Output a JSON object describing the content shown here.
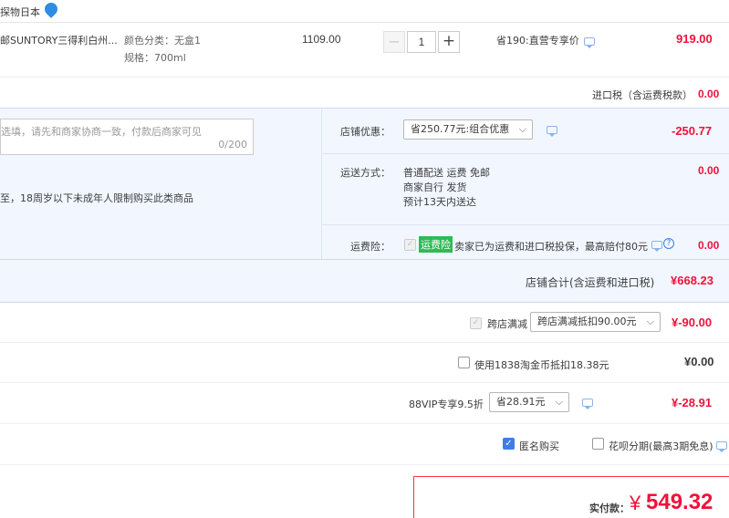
{
  "store": {
    "name": "探物日本"
  },
  "item": {
    "title": "邮SUNTORY三得利白州...",
    "sku_color": "颜色分类：无盒1",
    "sku_spec": "规格：700ml",
    "unit_price": "1109.00",
    "quantity": "1",
    "promo": "省190:直营专享价",
    "subtotal": "919.00"
  },
  "import_tax": {
    "label": "进口税（含运费税款）",
    "value": "0.00"
  },
  "message": {
    "placeholder": "选填，请先和商家协商一致，付款后商家可见",
    "counter": "0/200"
  },
  "notice": "至，18周岁以下未成年人限制购买此类商品",
  "shop_discount": {
    "label": "店铺优惠：",
    "selected": "省250.77元:组合优惠",
    "value": "-250.77"
  },
  "shipping": {
    "label": "运送方式：",
    "line1": "普通配送 运费 免邮",
    "line2": "商家自行  发货",
    "line3": "预计13天内送达",
    "value": "0.00"
  },
  "insurance": {
    "label": "运费险：",
    "badge": "运费险",
    "text": "卖家已为运费和进口税投保，最高赔付80元",
    "help": "?",
    "value": "0.00"
  },
  "shop_total": {
    "label": "店铺合计(含运费和进口税)",
    "value": "¥668.23"
  },
  "cross_store": {
    "label": "跨店满减",
    "selected": "跨店满减抵扣90.00元",
    "value": "¥-90.00"
  },
  "coins": {
    "label": "使用1838淘金币抵扣18.38元",
    "value": "¥0.00"
  },
  "vip": {
    "label": "88VIP专享9.5折",
    "selected": "省28.91元",
    "value": "¥-28.91"
  },
  "anonymous": {
    "label": "匿名购买"
  },
  "huabei": {
    "label": "花呗分期(最高3期免息)"
  },
  "actual": {
    "label": "实付款：",
    "currency": "¥",
    "amount": "549.32"
  },
  "colors": {
    "price_red": "#f1113a",
    "accent_blue": "#3e7ee6",
    "panel_bg": "#f2f7ff",
    "badge_green": "#2dbb55"
  }
}
